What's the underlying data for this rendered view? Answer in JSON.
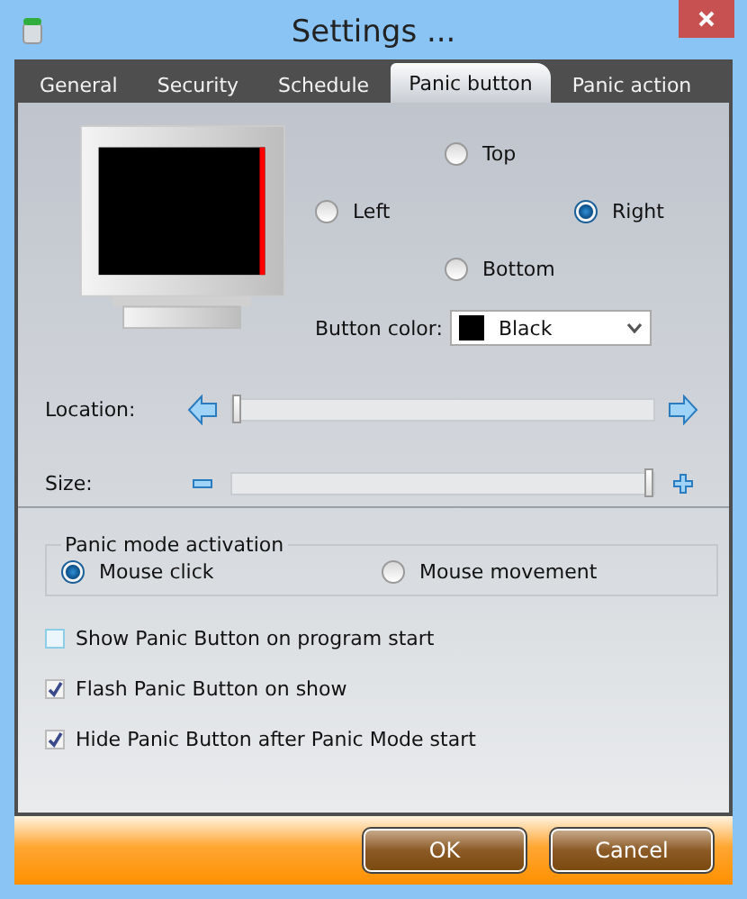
{
  "window": {
    "title": "Settings ..."
  },
  "tabs": [
    {
      "label": "General",
      "selected": false
    },
    {
      "label": "Security",
      "selected": false
    },
    {
      "label": "Schedule",
      "selected": false
    },
    {
      "label": "Panic button",
      "selected": true
    },
    {
      "label": "Panic action",
      "selected": false
    }
  ],
  "position": [
    {
      "label": "Top",
      "selected": false
    },
    {
      "label": "Left",
      "selected": false
    },
    {
      "label": "Right",
      "selected": true
    },
    {
      "label": "Bottom",
      "selected": false
    }
  ],
  "button_color": {
    "label": "Button color:",
    "value": "Black",
    "color": "#000000"
  },
  "location": {
    "label": "Location:",
    "level": 0
  },
  "size": {
    "label": "Size:",
    "level": 1
  },
  "activation": {
    "title": "Panic mode activation",
    "options": [
      {
        "label": "Mouse click",
        "selected": true
      },
      {
        "label": "Mouse movement",
        "selected": false
      }
    ]
  },
  "checkboxes": [
    {
      "label": "Show Panic Button on program start",
      "checked": false
    },
    {
      "label": "Flash Panic Button on show",
      "checked": true
    },
    {
      "label": "Hide Panic Button after Panic Mode start",
      "checked": true
    }
  ],
  "buttons": [
    "OK",
    "Cancel"
  ]
}
